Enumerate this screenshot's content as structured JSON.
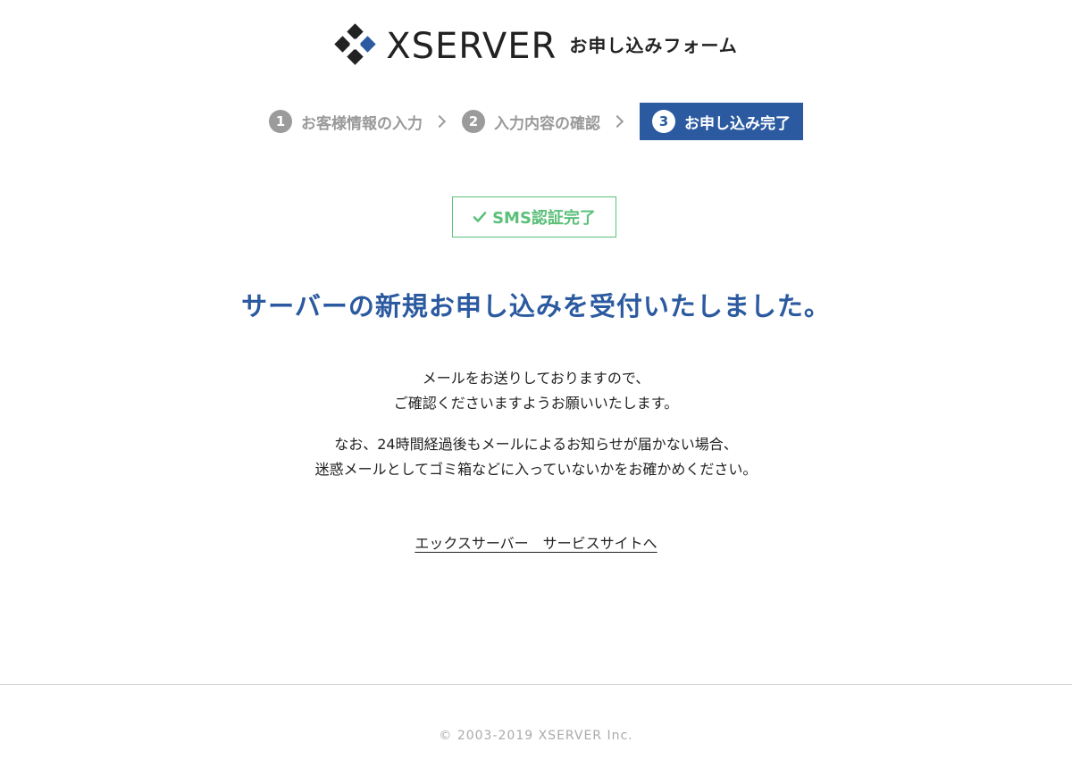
{
  "header": {
    "logo_text": "XSERVER",
    "form_title": "お申し込みフォーム"
  },
  "steps": [
    {
      "number": "1",
      "label": "お客様情報の入力",
      "active": false
    },
    {
      "number": "2",
      "label": "入力内容の確認",
      "active": false
    },
    {
      "number": "3",
      "label": "お申し込み完了",
      "active": true
    }
  ],
  "sms_badge": {
    "label": "SMS認証完了",
    "icon": "check-icon"
  },
  "main": {
    "heading": "サーバーの新規お申し込みを受付いたしました。",
    "paragraph1": [
      "メールをお送りしておりますので、",
      "ご確認くださいますようお願いいたします。"
    ],
    "paragraph2": [
      "なお、24時間経過後もメールによるお知らせが届かない場合、",
      "迷惑メールとしてゴミ箱などに入っていないかをお確かめください。"
    ],
    "service_link": "エックスサーバー　サービスサイトへ"
  },
  "footer": {
    "copyright": "© 2003-2019 XSERVER Inc."
  },
  "colors": {
    "brand_blue": "#2b5aa0",
    "success_green": "#5cc07a",
    "inactive_gray": "#9b9b9b"
  }
}
